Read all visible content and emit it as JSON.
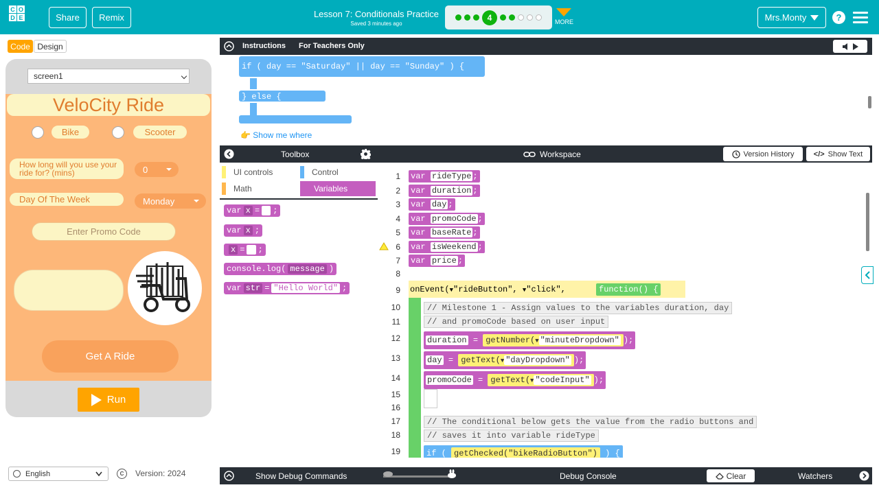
{
  "header": {
    "logo_letters": [
      "C",
      "O",
      "D",
      "E"
    ],
    "share_label": "Share",
    "remix_label": "Remix",
    "lesson_title": "Lesson 7: Conditionals Practice",
    "saved_status": "Saved 3 minutes ago",
    "current_level": "4",
    "progress": {
      "completed_before": 3,
      "completed_after": 2,
      "remaining": 3
    },
    "more_label": "MORE",
    "user_name": "Mrs.Monty",
    "accent_color": "#00adbc"
  },
  "mode_tabs": {
    "code_label": "Code",
    "design_label": "Design",
    "active": "Code"
  },
  "app_preview": {
    "screen_select": "screen1",
    "title": "VeloCity Ride",
    "radio_bike_label": "Bike",
    "radio_scooter_label": "Scooter",
    "duration_question": "How long will you use your ride for? (mins)",
    "duration_value": "0",
    "day_label": "Day Of The Week",
    "day_value": "Monday",
    "promo_placeholder": "Enter Promo Code",
    "get_ride_label": "Get A Ride",
    "background_color": "#fdb779"
  },
  "run_label": "Run",
  "footer": {
    "language": "English",
    "version": "Version: 2024"
  },
  "instructions": {
    "tab_instructions": "Instructions",
    "tab_teachers": "For Teachers Only",
    "code_if_line": "if ( day == \"Saturday\" || day == \"Sunday\" ) {",
    "code_else": "} else {",
    "show_me_where": "Show me where"
  },
  "toolbox": {
    "title": "Toolbox",
    "categories": [
      {
        "label": "UI controls",
        "color": "#fff176"
      },
      {
        "label": "Control",
        "color": "#64b5f6"
      },
      {
        "label": "Math",
        "color": "#ffb74d"
      },
      {
        "label": "Variables",
        "color": "#c45ebf"
      }
    ],
    "active_category": "Variables",
    "blocks": {
      "b1_kw": "var",
      "b1_name": "x",
      "b1_eq": "=",
      "b2_kw": "var",
      "b2_name": "x",
      "b3_name": "x",
      "b3_eq": "=",
      "b4_fn": "console.log",
      "b4_arg": "message",
      "b5_kw": "var",
      "b5_name": "str",
      "b5_eq": "=",
      "b5_val": "\"Hello World\""
    }
  },
  "workspace": {
    "title": "Workspace",
    "version_history_label": "Version History",
    "show_text_label": "Show Text",
    "lines": [
      {
        "num": "1",
        "kw": "var",
        "name": "rideType"
      },
      {
        "num": "2",
        "kw": "var",
        "name": "duration"
      },
      {
        "num": "3",
        "kw": "var",
        "name": "day"
      },
      {
        "num": "4",
        "kw": "var",
        "name": "promoCode"
      },
      {
        "num": "5",
        "kw": "var",
        "name": "baseRate"
      },
      {
        "num": "6",
        "kw": "var",
        "name": "isWeekend"
      },
      {
        "num": "7",
        "kw": "var",
        "name": "price"
      },
      {
        "num": "8"
      },
      {
        "num": "9",
        "on_event": "onEvent(",
        "target": "\"rideButton\",",
        "event": "\"click\",",
        "function": "function()",
        "brace": "{"
      },
      {
        "num": "10",
        "comment": "// Milestone 1 - Assign values to the variables duration, day"
      },
      {
        "num": "11",
        "comment": "// and promoCode based on user input"
      },
      {
        "num": "12",
        "lhs": "duration",
        "eq": "=",
        "fn": "getNumber(",
        "arg": "\"minuteDropdown\"",
        "close": ");"
      },
      {
        "num": "13",
        "lhs": "day",
        "eq": "=",
        "fn": "getText(",
        "arg": "\"dayDropdown\"",
        "close": ");"
      },
      {
        "num": "14",
        "lhs": "promoCode",
        "eq": "=",
        "fn": "getText(",
        "arg": "\"codeInput\"",
        "close": ");"
      },
      {
        "num": "15"
      },
      {
        "num": "16"
      },
      {
        "num": "17",
        "comment": "// The conditional below gets the value from the radio buttons and"
      },
      {
        "num": "18",
        "comment": "// saves it into variable rideType"
      },
      {
        "num": "19",
        "if_kw": "if (",
        "fn": "getChecked(\"bikeRadioButton\")",
        "close": ") {"
      }
    ]
  },
  "debug": {
    "show_commands_label": "Show Debug Commands",
    "console_label": "Debug Console",
    "clear_label": "Clear",
    "watchers_label": "Watchers"
  }
}
